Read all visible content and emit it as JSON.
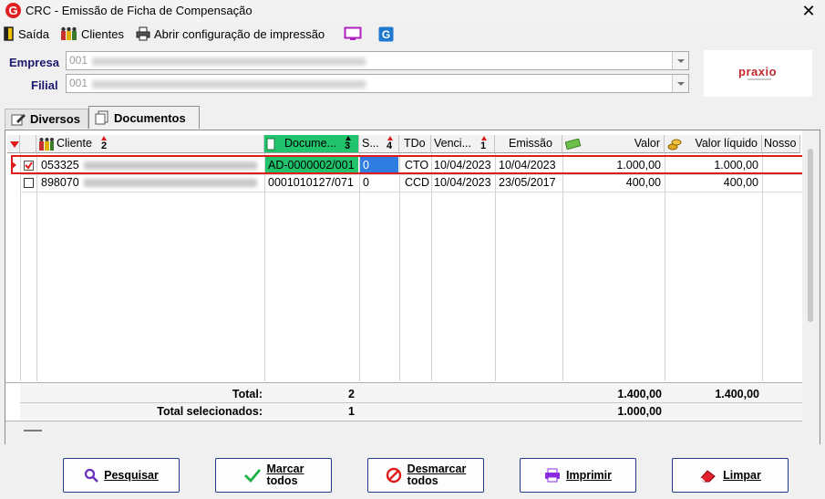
{
  "window": {
    "title": "CRC - Emissão de Ficha de Compensação",
    "close_glyph": "✕"
  },
  "toolbar": {
    "exit_label": "Saída",
    "clients_label": "Clientes",
    "print_config_label": "Abrir configuração de impressão"
  },
  "filters": {
    "empresa_label": "Empresa",
    "empresa_value": "001",
    "filial_label": "Filial",
    "filial_value": "001"
  },
  "logo": {
    "text": "praxio"
  },
  "tabs": [
    {
      "label": "Diversos",
      "active": false
    },
    {
      "label": "Documentos",
      "active": true
    }
  ],
  "grid": {
    "columns": [
      {
        "label": "Cliente",
        "sort": "2"
      },
      {
        "label": "Docume...",
        "sort": "3"
      },
      {
        "label": "S...",
        "sort": "4"
      },
      {
        "label": "TDo",
        "sort": ""
      },
      {
        "label": "Venci...",
        "sort": "1"
      },
      {
        "label": "Emissão",
        "sort": ""
      },
      {
        "label": "Valor",
        "sort": ""
      },
      {
        "label": "Valor líquido",
        "sort": ""
      },
      {
        "label": "Nosso",
        "sort": ""
      }
    ],
    "rows": [
      {
        "checked": true,
        "cliente": "053325",
        "documento": "AD-0000002/001",
        "s": "0",
        "tdo": "CTO",
        "vencimento": "10/04/2023",
        "emissao": "10/04/2023",
        "valor": "1.000,00",
        "valor_liquido": "1.000,00"
      },
      {
        "checked": false,
        "cliente": "898070",
        "documento": "0001010127/071",
        "s": "0",
        "tdo": "CCD",
        "vencimento": "10/04/2023",
        "emissao": "23/05/2017",
        "valor": "400,00",
        "valor_liquido": "400,00"
      }
    ],
    "totals": [
      {
        "label": "Total:",
        "count": "2",
        "valor": "1.400,00",
        "valor_liquido": "1.400,00"
      },
      {
        "label": "Total selecionados:",
        "count": "1",
        "valor": "1.000,00",
        "valor_liquido": ""
      }
    ]
  },
  "buttons": {
    "pesquisar": "Pesquisar",
    "marcar_1": "Marcar",
    "marcar_2": "todos",
    "desmarcar_1": "Desmarcar",
    "desmarcar_2": "todos",
    "imprimir": "Imprimir",
    "limpar": "Limpar"
  },
  "colors": {
    "accent_sorted": "#21c46c",
    "selection": "#e01b1b",
    "cell_highlight": "#2f7de1",
    "button_border": "#1e3a8a"
  }
}
